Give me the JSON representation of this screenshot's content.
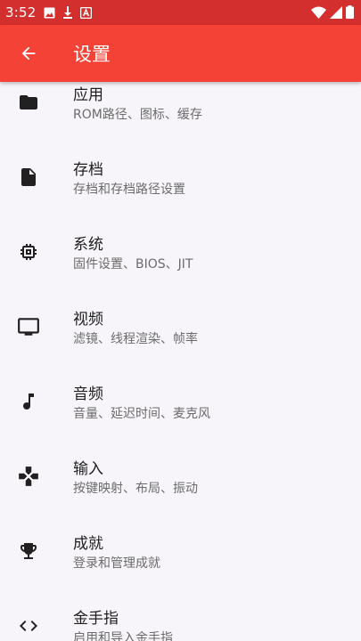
{
  "status_bar": {
    "time": "3:52"
  },
  "app_bar": {
    "title": "设置"
  },
  "settings": [
    {
      "title": "应用",
      "subtitle": "ROM路径、图标、缓存"
    },
    {
      "title": "存档",
      "subtitle": "存档和存档路径设置"
    },
    {
      "title": "系统",
      "subtitle": "固件设置、BIOS、JIT"
    },
    {
      "title": "视频",
      "subtitle": "滤镜、线程渲染、帧率"
    },
    {
      "title": "音频",
      "subtitle": "音量、延迟时间、麦克风"
    },
    {
      "title": "输入",
      "subtitle": "按键映射、布局、振动"
    },
    {
      "title": "成就",
      "subtitle": "登录和管理成就"
    },
    {
      "title": "金手指",
      "subtitle": "启用和导入金手指"
    }
  ],
  "colors": {
    "status_bar": "#d32f2f",
    "app_bar": "#f44336",
    "background": "#f7f5f9"
  }
}
